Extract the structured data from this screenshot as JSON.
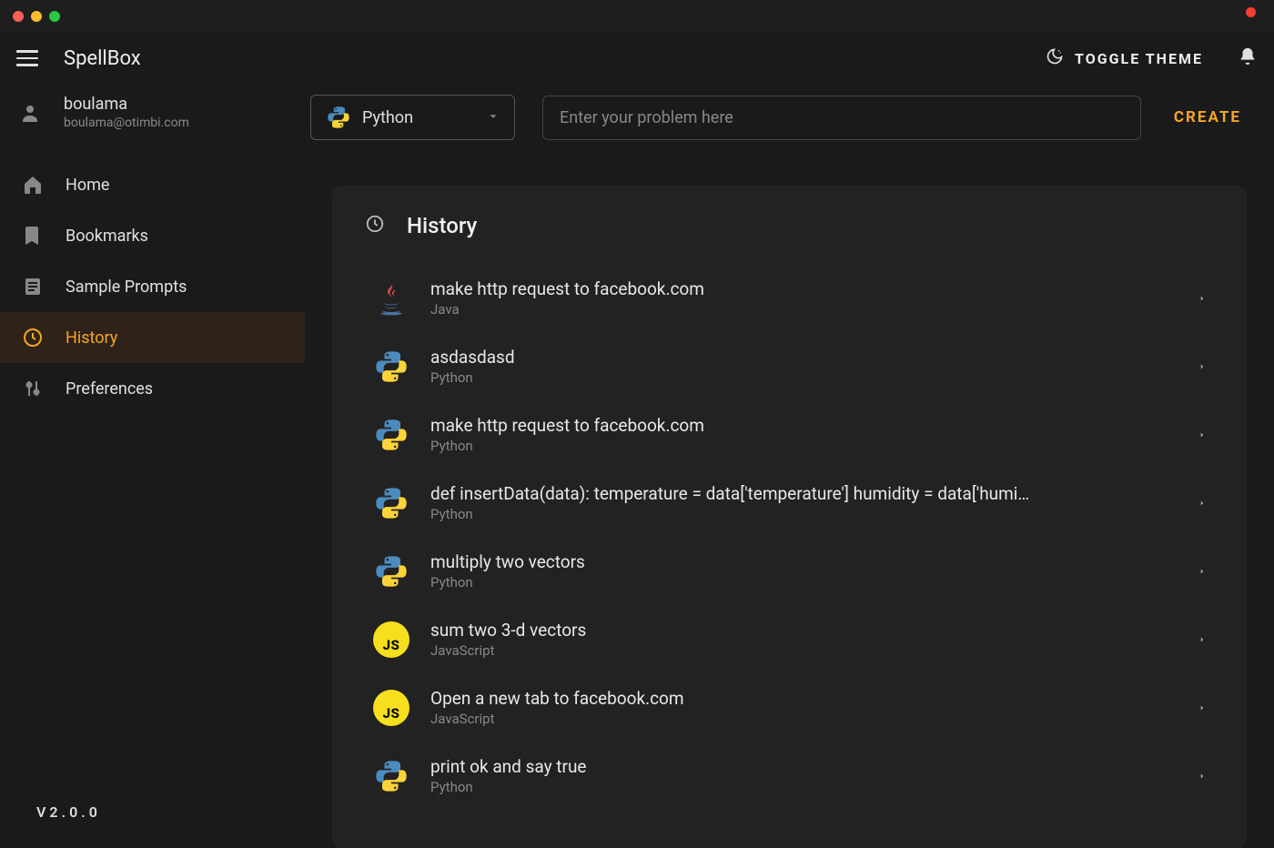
{
  "app": {
    "title": "SpellBox"
  },
  "header": {
    "toggle_theme_label": "TOGGLE THEME"
  },
  "user": {
    "name": "boulama",
    "email": "boulama@otimbi.com"
  },
  "sidebar": {
    "items": [
      {
        "label": "Home"
      },
      {
        "label": "Bookmarks"
      },
      {
        "label": "Sample Prompts"
      },
      {
        "label": "History"
      },
      {
        "label": "Preferences"
      }
    ]
  },
  "version": "V2.0.0",
  "toolbar": {
    "language_selected": "Python",
    "prompt_placeholder": "Enter your problem here",
    "create_label": "CREATE"
  },
  "panel": {
    "title": "History"
  },
  "history": [
    {
      "title": "make http request to facebook.com",
      "language": "Java",
      "icon": "java"
    },
    {
      "title": "asdasdasd",
      "language": "Python",
      "icon": "python"
    },
    {
      "title": "make http request to facebook.com",
      "language": "Python",
      "icon": "python"
    },
    {
      "title": "def insertData(data): temperature = data['temperature'] humidity = data['humi…",
      "language": "Python",
      "icon": "python"
    },
    {
      "title": "multiply two vectors",
      "language": "Python",
      "icon": "python"
    },
    {
      "title": "sum two 3-d vectors",
      "language": "JavaScript",
      "icon": "javascript"
    },
    {
      "title": "Open a new tab to facebook.com",
      "language": "JavaScript",
      "icon": "javascript"
    },
    {
      "title": "print ok and say true",
      "language": "Python",
      "icon": "python"
    }
  ],
  "colors": {
    "accent": "#f5a623",
    "bg": "#1a1a1a",
    "panel": "#222222"
  }
}
